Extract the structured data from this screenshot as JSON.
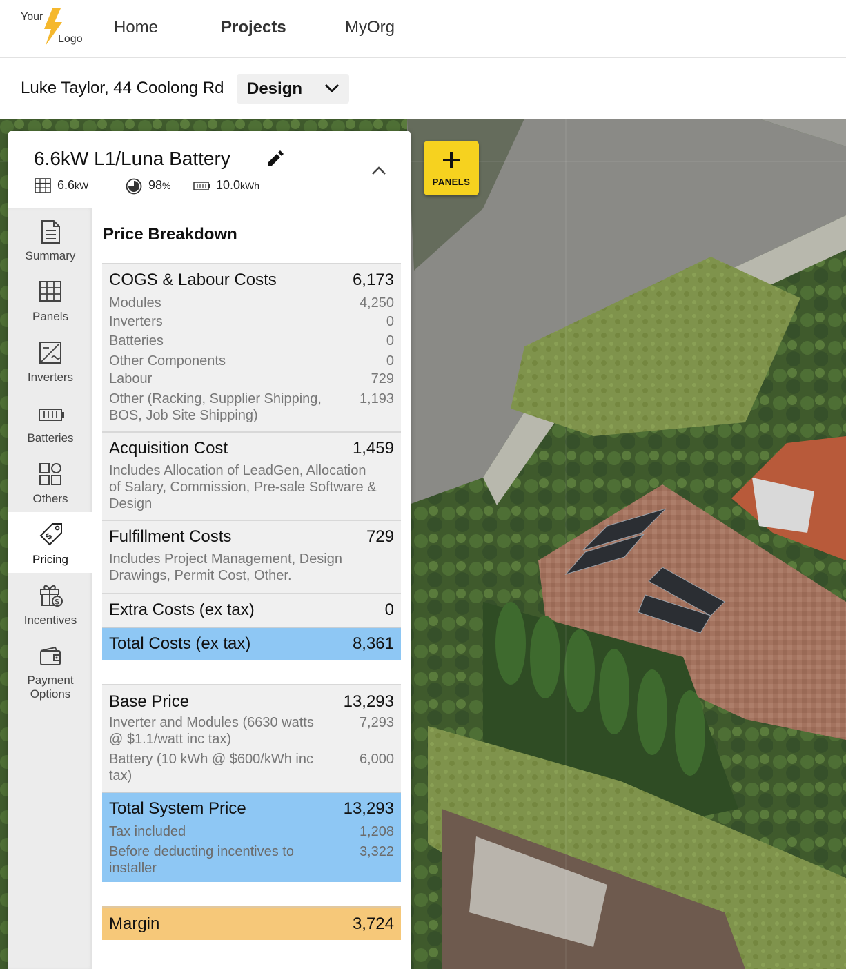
{
  "nav": {
    "logo_top": "Your",
    "logo_bottom": "Logo",
    "links": [
      "Home",
      "Projects",
      "MyOrg"
    ]
  },
  "project": {
    "name": "Luke Taylor, 44 Coolong Rd",
    "mode": "Design"
  },
  "map": {
    "panels_button": "PANELS"
  },
  "system": {
    "title": "6.6kW L1/Luna Battery",
    "size": "6.6",
    "size_unit": "kW",
    "offset": "98",
    "offset_unit": "%",
    "battery": "10.0",
    "battery_unit": "kWh"
  },
  "tabs": [
    "Summary",
    "Panels",
    "Inverters",
    "Batteries",
    "Others",
    "Pricing",
    "Incentives",
    "Payment Options"
  ],
  "active_tab": "Pricing",
  "pricing": {
    "title": "Price Breakdown",
    "cogs": {
      "label": "COGS & Labour Costs",
      "value": "6,173",
      "items": [
        {
          "label": "Modules",
          "value": "4,250"
        },
        {
          "label": "Inverters",
          "value": "0"
        },
        {
          "label": "Batteries",
          "value": "0"
        },
        {
          "label": "Other Components",
          "value": "0"
        },
        {
          "label": "Labour",
          "value": "729"
        },
        {
          "label": "Other (Racking, Supplier Shipping,",
          "label2": "BOS, Job Site Shipping)",
          "value": "1,193"
        }
      ]
    },
    "acquisition": {
      "label": "Acquisition Cost",
      "value": "1,459",
      "desc": [
        "Includes Allocation of LeadGen, Allocation",
        "of Salary, Commission, Pre-sale Software &",
        "Design"
      ]
    },
    "fulfillment": {
      "label": "Fulfillment Costs",
      "value": "729",
      "desc": [
        "Includes Project Management, Design",
        "Drawings, Permit Cost, Other."
      ]
    },
    "extra": {
      "label": "Extra Costs (ex tax)",
      "value": "0"
    },
    "total_costs": {
      "label": "Total Costs (ex tax)",
      "value": "8,361"
    },
    "base_price": {
      "label": "Base Price",
      "value": "13,293",
      "items": [
        {
          "label": "Inverter and Modules (6630 watts",
          "label2": "@ $1.1/watt inc tax)",
          "value": "7,293"
        },
        {
          "label": "Battery (10 kWh @ $600/kWh inc",
          "label2": "tax)",
          "value": "6,000"
        }
      ]
    },
    "total_system_price": {
      "label": "Total System Price",
      "value": "13,293",
      "items": [
        {
          "label": "Tax included",
          "value": "1,208"
        },
        {
          "label": "Before deducting incentives to",
          "label2": "installer",
          "value": "3,322"
        }
      ]
    },
    "margin": {
      "label": "Margin",
      "value": "3,724"
    }
  },
  "colors": {
    "accent_yellow": "#f6d21f",
    "total_blue": "#8ec7f4",
    "margin_orange": "#f6c879"
  }
}
